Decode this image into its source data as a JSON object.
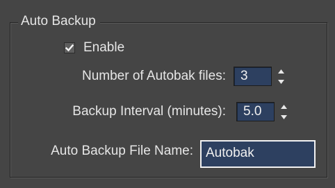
{
  "group": {
    "title": "Auto Backup"
  },
  "enable": {
    "label": "Enable",
    "checked": true
  },
  "num_files": {
    "label": "Number of Autobak files:",
    "value": "3"
  },
  "interval": {
    "label": "Backup Interval (minutes):",
    "value": "5.0"
  },
  "file_name": {
    "label": "Auto Backup File Name:",
    "value": "Autobak"
  },
  "colors": {
    "panel_bg": "#454545",
    "field_bg": "#2d4060",
    "text": "#e6e6e6"
  },
  "icons": {
    "check": "checkmark-icon",
    "spin_up": "arrow-up-icon",
    "spin_down": "arrow-down-icon"
  }
}
